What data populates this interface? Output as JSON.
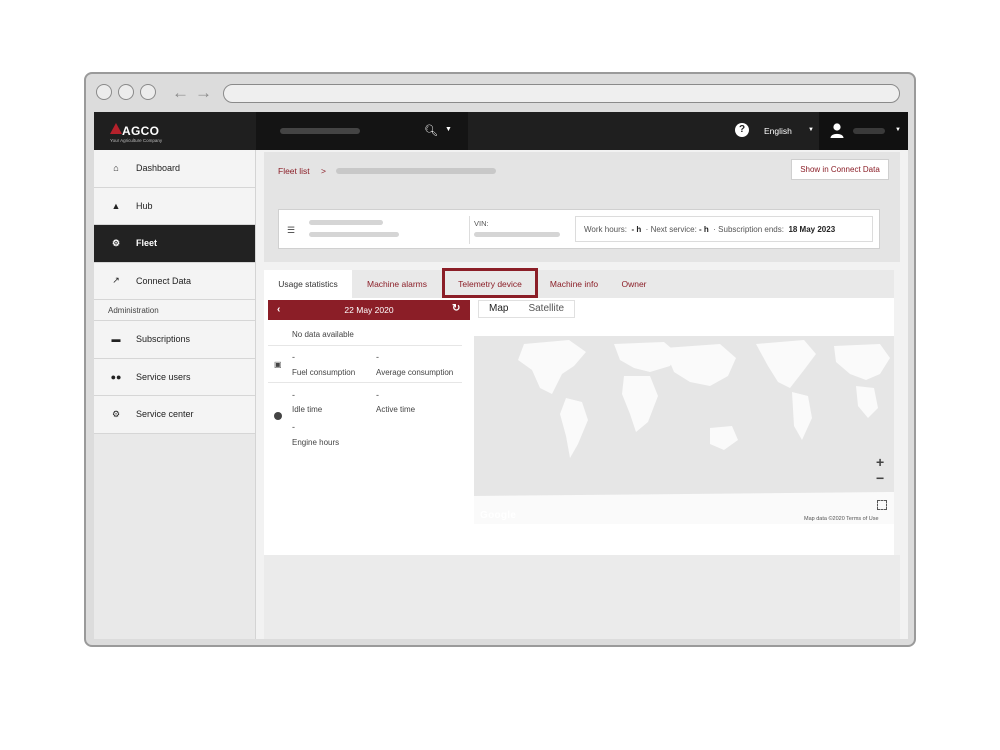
{
  "topbar": {
    "brand": "AGCO",
    "brand_tagline": "Your Agriculture Company",
    "language": "English"
  },
  "sidebar": {
    "items": [
      {
        "label": "Dashboard",
        "icon": "home-icon"
      },
      {
        "label": "Hub",
        "icon": "bell-icon"
      },
      {
        "label": "Fleet",
        "icon": "tractor-icon",
        "active": true
      },
      {
        "label": "Connect Data",
        "icon": "chart-icon"
      }
    ],
    "admin_heading": "Administration",
    "admin_items": [
      {
        "label": "Subscriptions",
        "icon": "card-icon"
      },
      {
        "label": "Service users",
        "icon": "users-icon"
      },
      {
        "label": "Service center",
        "icon": "gear-icon"
      }
    ]
  },
  "breadcrumb": {
    "root": "Fleet list",
    "separator": ">",
    "connect_button": "Show in Connect Data"
  },
  "machine": {
    "vin_label": "VIN:",
    "work_hours_label": "Work hours:",
    "work_hours_value": "- h",
    "next_service_label": "Next service:",
    "next_service_value": "- h",
    "subscription_label": "Subscription ends:",
    "subscription_value": "18 May 2023"
  },
  "tabs": [
    "Usage statistics",
    "Machine alarms",
    "Telemetry device",
    "Machine info",
    "Owner"
  ],
  "usage": {
    "date": "22 May 2020",
    "no_data": "No data available",
    "fuel_consumption_value": "-",
    "fuel_consumption_label": "Fuel consumption",
    "avg_consumption_value": "-",
    "avg_consumption_label": "Average consumption",
    "idle_time_value": "-",
    "idle_time_label": "Idle time",
    "active_time_value": "-",
    "active_time_label": "Active time",
    "engine_hours_value": "-",
    "engine_hours_label": "Engine hours"
  },
  "map": {
    "map_label": "Map",
    "satellite_label": "Satellite",
    "zoom_in": "+",
    "zoom_out": "−",
    "google": "Google",
    "attribution": "Map data ©2020   Terms of Use"
  },
  "colors": {
    "accent": "#8b1e27",
    "topbar": "#1f1f1f",
    "sidebar_active": "#222222"
  }
}
